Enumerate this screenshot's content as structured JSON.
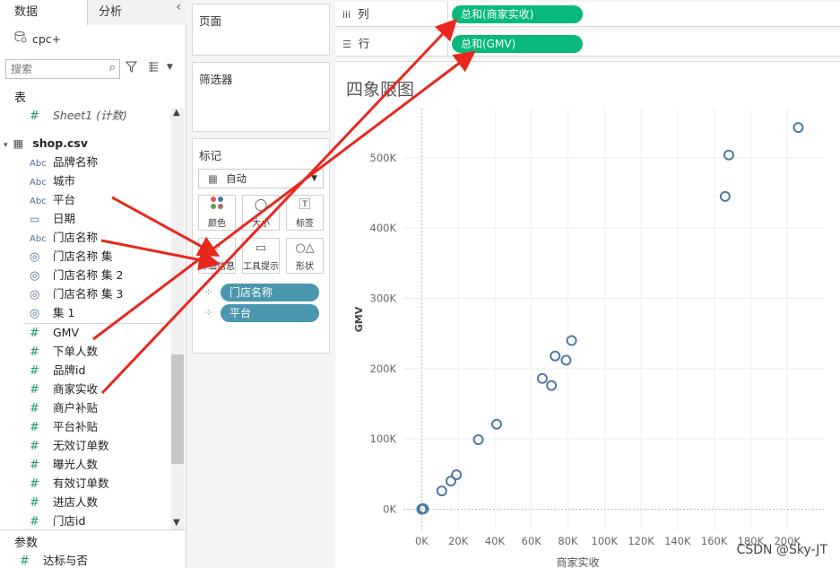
{
  "left_pane": {
    "tabs": {
      "data": "数据",
      "analysis": "分析"
    },
    "collapse_glyph": "‹",
    "datasource": "cpc+",
    "search": {
      "placeholder": "搜索"
    },
    "tables_section": "表",
    "sheet_count_field": "Sheet1 (计数)",
    "table_name": "shop.csv",
    "dimensions": [
      {
        "type": "Abc",
        "label": "品牌名称"
      },
      {
        "type": "Abc",
        "label": "城市"
      },
      {
        "type": "Abc",
        "label": "平台"
      },
      {
        "type": "date",
        "label": "日期"
      },
      {
        "type": "Abc",
        "label": "门店名称"
      },
      {
        "type": "set",
        "label": "门店名称 集"
      },
      {
        "type": "set",
        "label": "门店名称 集 2"
      },
      {
        "type": "set",
        "label": "门店名称 集 3"
      },
      {
        "type": "set",
        "label": "集 1"
      }
    ],
    "measures": [
      "GMV",
      "下单人数",
      "品牌id",
      "商家实收",
      "商户补贴",
      "平台补贴",
      "无效订单数",
      "曝光人数",
      "有效订单数",
      "进店人数",
      "门店id"
    ],
    "params_section": "参数",
    "params": [
      "达标与否"
    ]
  },
  "shelves": {
    "pages": "页面",
    "filters": "筛选器",
    "marks": "标记",
    "mark_type": "自动",
    "mark_buttons": [
      "颜色",
      "大小",
      "标签",
      "详细信息",
      "工具提示",
      "形状"
    ],
    "mark_pills": [
      "门店名称",
      "平台"
    ]
  },
  "columns_shelf": {
    "label": "列",
    "pill": "总和(商家实收)"
  },
  "rows_shelf": {
    "label": "行",
    "pill": "总和(GMV)"
  },
  "sheet": {
    "title": "四象限图"
  },
  "colors": {
    "accent_green": "#08b97b",
    "pill_teal": "#4a97ae",
    "mark_stroke": "#4e79a7",
    "annotation_red": "#e8281e"
  },
  "chart_data": {
    "type": "scatter",
    "xlabel": "商家实收",
    "ylabel": "GMV",
    "x_ticks": [
      "0K",
      "20K",
      "40K",
      "60K",
      "80K",
      "100K",
      "120K",
      "140K",
      "160K",
      "180K",
      "200K"
    ],
    "y_ticks": [
      "0K",
      "100K",
      "200K",
      "300K",
      "400K",
      "500K"
    ],
    "xlim": [
      -10000,
      220000
    ],
    "ylim": [
      -30000,
      570000
    ],
    "grid": true,
    "points": [
      {
        "x": 0,
        "y": 0
      },
      {
        "x": 500,
        "y": 1000
      },
      {
        "x": 1000,
        "y": 500
      },
      {
        "x": 11000,
        "y": 26000
      },
      {
        "x": 16000,
        "y": 40000
      },
      {
        "x": 19000,
        "y": 49000
      },
      {
        "x": 31000,
        "y": 99000
      },
      {
        "x": 41000,
        "y": 121000
      },
      {
        "x": 66000,
        "y": 186000
      },
      {
        "x": 71000,
        "y": 176000
      },
      {
        "x": 73000,
        "y": 218000
      },
      {
        "x": 79000,
        "y": 212000
      },
      {
        "x": 82000,
        "y": 240000
      },
      {
        "x": 166000,
        "y": 445000
      },
      {
        "x": 168000,
        "y": 504000
      },
      {
        "x": 206000,
        "y": 543000
      }
    ]
  },
  "watermark": "CSDN @Sky-JT"
}
